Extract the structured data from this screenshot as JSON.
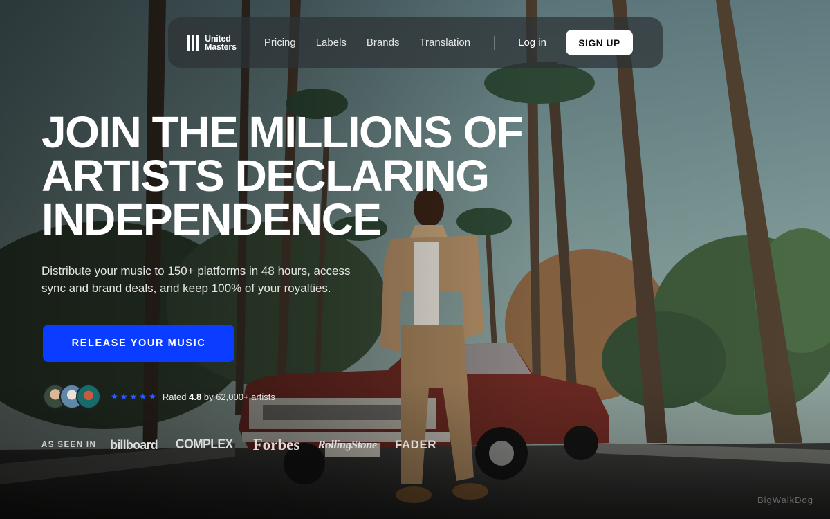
{
  "brand": {
    "logo_line1": "United",
    "logo_line2": "Masters"
  },
  "nav": {
    "links": [
      "Pricing",
      "Labels",
      "Brands",
      "Translation"
    ],
    "login_label": "Log in",
    "signup_label": "SIGN UP"
  },
  "hero": {
    "headline_lines": [
      "JOIN THE MILLIONS OF",
      "ARTISTS DECLARING",
      "INDEPENDENCE"
    ],
    "subtext_line1": "Distribute your music to 150+ platforms in 48 hours, access",
    "subtext_line2": "sync and brand deals, and keep 100% of your royalties.",
    "cta_label": "RELEASE YOUR MUSIC"
  },
  "rating": {
    "stars": 5,
    "prefix": "Rated",
    "score": "4.8",
    "suffix": "by 62,000+ artists"
  },
  "press": {
    "label": "AS SEEN IN",
    "outlets": [
      "billboard",
      "COMPLEX",
      "Forbes",
      "RollingStone",
      "FADER"
    ]
  },
  "watermark": "BigWalkDog",
  "colors": {
    "cta": "#0a3dff",
    "stars": "#2e5bff",
    "signup_bg": "#ffffff"
  }
}
